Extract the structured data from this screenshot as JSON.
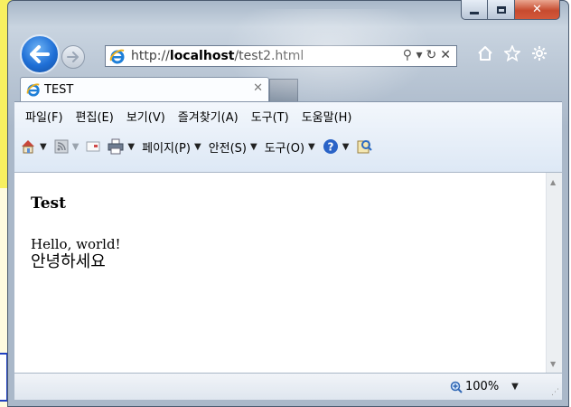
{
  "browser": {
    "address_url_prefix": "http://",
    "address_url_host": "localhost",
    "address_url_path": "/test2.html",
    "search_glyph": "⚲ ▾",
    "refresh_glyph": "↻",
    "stop_glyph": "✕",
    "tab_title": "TEST",
    "tab_close": "✕"
  },
  "menu": [
    "파일(F)",
    "편집(E)",
    "보기(V)",
    "즐겨찾기(A)",
    "도구(T)",
    "도움말(H)"
  ],
  "commands": {
    "page": "페이지(P)",
    "safety": "안전(S)",
    "tools": "도구(O)"
  },
  "page": {
    "heading": "Test",
    "line1": "Hello, world!",
    "line2": "안녕하세요"
  },
  "status": {
    "zoom": "100%"
  },
  "icons": {
    "back": "back-icon",
    "forward": "forward-icon",
    "ie": "ie-icon",
    "home": "home-icon",
    "favorites": "star-icon",
    "settings": "gear-icon"
  }
}
